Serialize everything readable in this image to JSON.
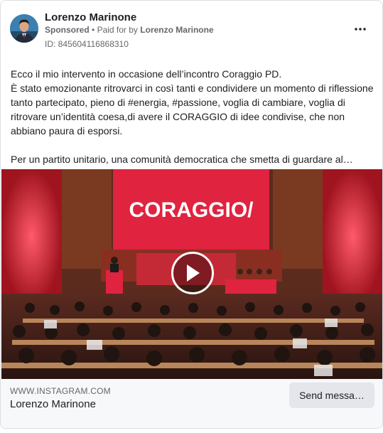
{
  "post": {
    "author": "Lorenzo Marinone",
    "sponsored_label": "Sponsored",
    "separator": "•",
    "paid_for_prefix": "Paid for by",
    "paid_for_name": "Lorenzo Marinone",
    "ad_id": "ID: 845604116868310",
    "more_icon": "ellipsis-icon",
    "text": {
      "line1": "Ecco il mio intervento in occasione dell’incontro Coraggio PD.",
      "line2": "È stato emozionante ritrovarci in così tanti e condividere un momento di riflessione tanto partecipato, pieno di #energia, #passione, voglia di cambiare, voglia di ritrovare un’identità coesa,di avere il CORAGGIO di idee condivise, che non abbiano paura di esporsi.",
      "line3": "Per un partito unitario, una comunità democratica che smetta di guardare al…"
    }
  },
  "video": {
    "screen_text": "CORAGGIO/",
    "podium_text": "CORAGGIO/",
    "play_icon": "play-icon"
  },
  "footer": {
    "domain": "WWW.INSTAGRAM.COM",
    "title": "Lorenzo Marinone",
    "cta_label": "Send messa…"
  },
  "colors": {
    "accent_red": "#e0233f",
    "text_primary": "#1c1e21",
    "text_secondary": "#65676b",
    "footer_bg": "#f7f8fa",
    "button_bg": "#e4e6eb"
  }
}
